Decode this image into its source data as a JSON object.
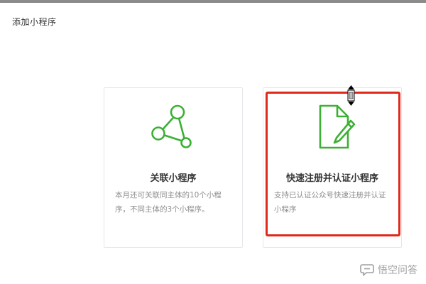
{
  "page": {
    "title": "添加小程序"
  },
  "cards": [
    {
      "title": "关联小程序",
      "description": "本月还可关联同主体的10个小程序，不同主体的3个小程序。",
      "icon": "network-nodes-icon"
    },
    {
      "title": "快速注册并认证小程序",
      "description": "支持已认证公众号快速注册并认证小程序",
      "icon": "document-edit-icon"
    }
  ],
  "watermark": {
    "text": "悟空问答",
    "icon": "chat-bubble-icon"
  },
  "colors": {
    "accent_green": "#3cb034",
    "highlight_red": "#e0281b",
    "card_border": "#e7e7eb",
    "top_bar": "#8b8b8b"
  }
}
